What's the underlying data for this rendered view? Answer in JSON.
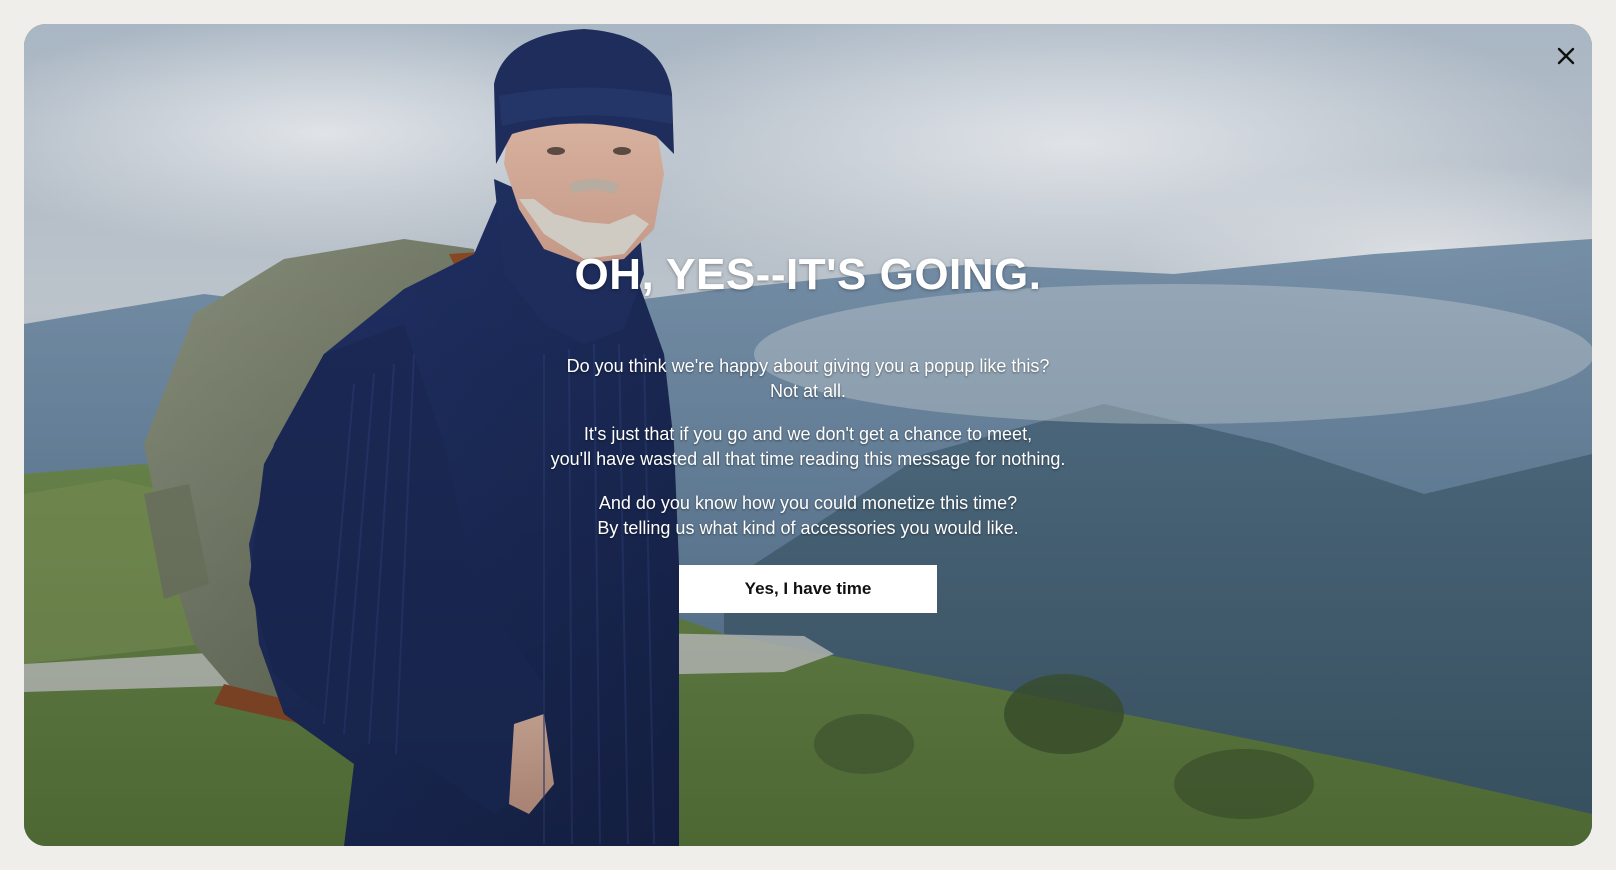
{
  "popup": {
    "headline": "OH, YES--IT'S GOING.",
    "paragraphs": [
      [
        "Do you think we're happy about giving you a popup like this?",
        "Not at all."
      ],
      [
        "It's just that if you go and we don't get a chance to meet,",
        "you'll have wasted all that time reading this message for nothing."
      ],
      [
        "And do you know how you could monetize this time?",
        "By telling us what kind of accessories you would like."
      ]
    ],
    "cta_label": "Yes, I have time",
    "close_icon": "close-icon"
  },
  "colors": {
    "frame_background": "#f0eeea",
    "sweater_navy": "#1c2b5a",
    "text": "#ffffff",
    "button_background": "#ffffff",
    "button_text": "#111111"
  }
}
